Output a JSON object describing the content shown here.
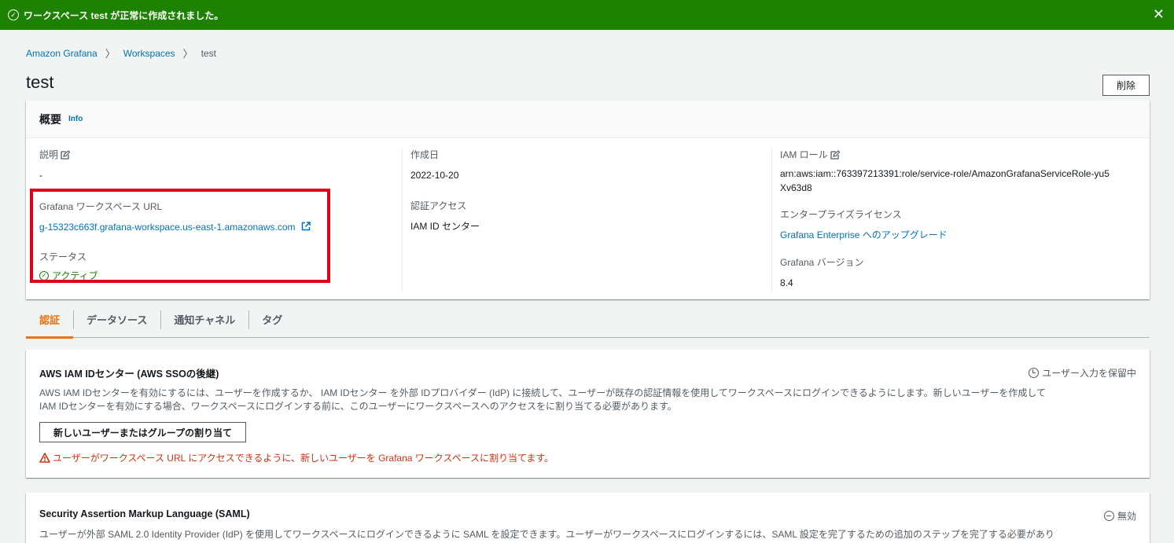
{
  "flash": {
    "message": "ワークスペース test が正常に作成されました。",
    "close": "✕"
  },
  "breadcrumb": {
    "items": [
      "Amazon Grafana",
      "Workspaces"
    ],
    "current": "test",
    "separator": "〉"
  },
  "page": {
    "title": "test",
    "delete_label": "削除"
  },
  "overview": {
    "heading": "概要",
    "info": "Info",
    "description_label": "説明",
    "description_value": "-",
    "url_label": "Grafana ワークスペース URL",
    "url_value": "g-15323c663f.grafana-workspace.us-east-1.amazonaws.com",
    "status_label": "ステータス",
    "status_value": "アクティブ",
    "created_label": "作成日",
    "created_value": "2022-10-20",
    "auth_label": "認証アクセス",
    "auth_value": "IAM ID センター",
    "role_label": "IAM ロール",
    "role_value": "arn:aws:iam::763397213391:role/service-role/AmazonGrafanaServiceRole-yu5Xv63d8",
    "license_label": "エンタープライズライセンス",
    "license_value": "Grafana Enterprise へのアップグレード",
    "version_label": "Grafana バージョン",
    "version_value": "8.4"
  },
  "tabs": [
    "認証",
    "データソース",
    "通知チャネル",
    "タグ"
  ],
  "sso": {
    "title": "AWS IAM IDセンター (AWS SSOの後継)",
    "state": "ユーザー入力を保留中",
    "desc1": "AWS IAM IDセンターを有効にするには、ユーザーを作成するか、 IAM IDセンター を外部 IDプロバイダー (IdP) に接続して、ユーザーが既存の認証情報を使用してワークスペースにログインできるようにします。新しいユーザーを作成して",
    "desc2": "IAM IDセンターを有効にする場合、ワークスペースにログインする前に、このユーザーにワークスペースへのアクセスをに割り当てる必要があります。",
    "button": "新しいユーザーまたはグループの割り当て",
    "warning": "ユーザーがワークスペース URL にアクセスできるように、新しいユーザーを Grafana ワークスペースに割り当てます。"
  },
  "saml": {
    "title": "Security Assertion Markup Language (SAML)",
    "state": "無効",
    "desc": "ユーザーが外部 SAML 2.0 Identity Provider (IdP) を使用してワークスペースにログインできるように SAML を設定できます。ユーザーがワークスペースにログインするには、SAML 設定を完了するための追加のステップを完了する必要があり"
  },
  "colors": {
    "success": "#1d8102",
    "link": "#0073bb",
    "accent": "#ec7211",
    "error": "#d13212",
    "highlight": "#e0001a"
  },
  "icons": [
    "check-circle-icon",
    "close-icon",
    "edit-icon",
    "external-link-icon",
    "clock-icon",
    "warning-icon",
    "minus-circle-icon"
  ]
}
